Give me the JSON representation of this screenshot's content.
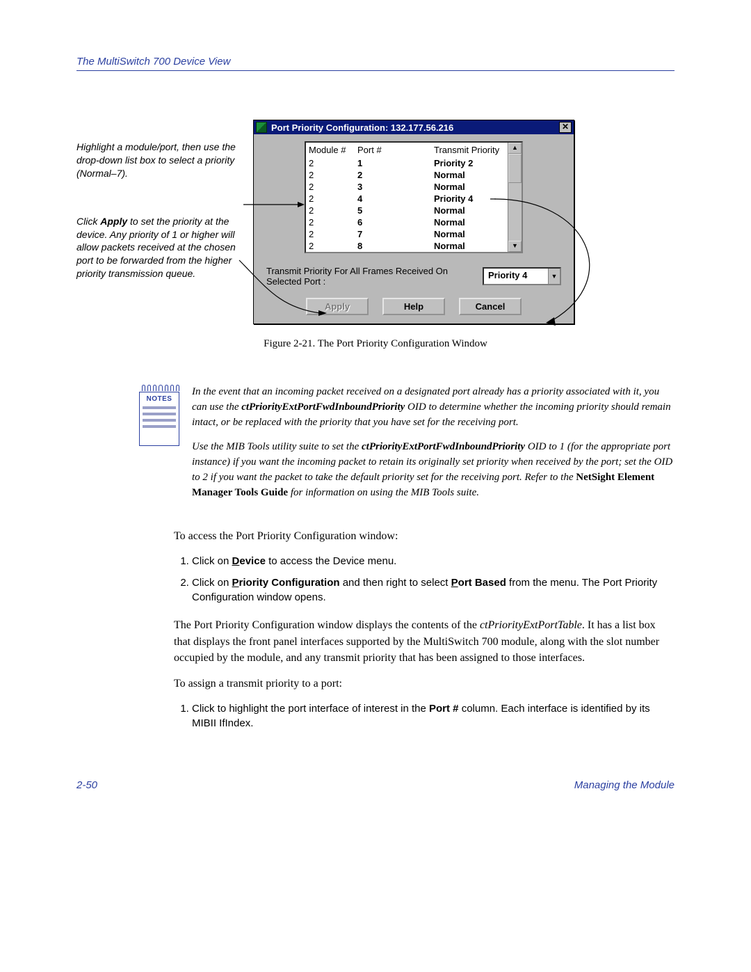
{
  "header": {
    "title": "The MultiSwitch 700 Device View"
  },
  "sideNotes": {
    "n1": "Highlight a module/port, then use the drop-down list box to select a priority (Normal–7).",
    "n2_pre": "Click ",
    "n2_bold": "Apply",
    "n2_post": " to set the priority at the device. Any priority of 1 or higher will allow packets received at the chosen port to be forwarded from the higher priority transmission queue."
  },
  "window": {
    "title": "Port Priority Configuration: 132.177.56.216",
    "closeGlyph": "✕",
    "columns": {
      "c1": "Module #",
      "c2": "Port #",
      "c3": "Transmit Priority"
    },
    "rows": [
      {
        "module": "2",
        "port": "1",
        "priority": "Priority 2"
      },
      {
        "module": "2",
        "port": "2",
        "priority": "Normal"
      },
      {
        "module": "2",
        "port": "3",
        "priority": "Normal"
      },
      {
        "module": "2",
        "port": "4",
        "priority": "Priority 4"
      },
      {
        "module": "2",
        "port": "5",
        "priority": "Normal"
      },
      {
        "module": "2",
        "port": "6",
        "priority": "Normal"
      },
      {
        "module": "2",
        "port": "7",
        "priority": "Normal"
      },
      {
        "module": "2",
        "port": "8",
        "priority": "Normal"
      }
    ],
    "scroll": {
      "up": "▲",
      "down": "▼"
    },
    "selectLabel": "Transmit Priority For All Frames Received On Selected Port :",
    "selectValue": "Priority 4",
    "ddGlyph": "▼",
    "buttons": {
      "apply": "Apply",
      "help": "Help",
      "cancel": "Cancel"
    }
  },
  "figureCaption": "Figure 2-21. The Port Priority Configuration Window",
  "notes": {
    "iconLabel": "NOTES",
    "p1_a": "In the event that an incoming packet received on a designated port already has a priority associated with it, you can use the ",
    "p1_b": "ctPriorityExtPortFwdInboundPriority",
    "p1_c": " OID to determine whether the incoming priority should remain intact, or be replaced with the priority that you have set for the receiving port.",
    "p2_a": "Use the MIB Tools utility suite to set the ",
    "p2_b": "ctPriorityExtPortFwdInboundPriority",
    "p2_c": " OID to 1 (for the appropriate port instance) if you want the incoming packet to retain its originally set priority when received by the port; set the OID to 2 if you want the packet to take the default priority set for the receiving port. Refer to the ",
    "p2_d": "NetSight Element Manager Tools Guide",
    "p2_e": " for information on using the MIB Tools suite."
  },
  "body": {
    "intro": "To access the Port Priority Configuration window:",
    "step1_a": "Click on ",
    "step1_b": "Device",
    "step1_b_letter": "D",
    "step1_c": " to access the Device menu.",
    "step2_a": "Click on ",
    "step2_b": "Priority Configuration",
    "step2_b_letter": "P",
    "step2_c": " and then right to select ",
    "step2_d": "Port Based",
    "step2_d_letter": "P",
    "step2_e": " from the menu. The Port Priority Configuration window opens.",
    "para_a": "The Port Priority Configuration window displays the contents of the ",
    "para_b": "ctPriorityExtPortTable",
    "para_c": ". It has a list box that displays the front panel interfaces supported by the MultiSwitch 700 module, along with the slot number occupied by the module, and any transmit priority that has been assigned to those interfaces.",
    "assign": "To assign a transmit priority to a port:",
    "astep1_a": "Click to highlight the port interface of interest in the ",
    "astep1_b": "Port #",
    "astep1_c": " column. Each interface is identified by its MIBII IfIndex."
  },
  "footer": {
    "left": "2-50",
    "right": "Managing the Module"
  }
}
